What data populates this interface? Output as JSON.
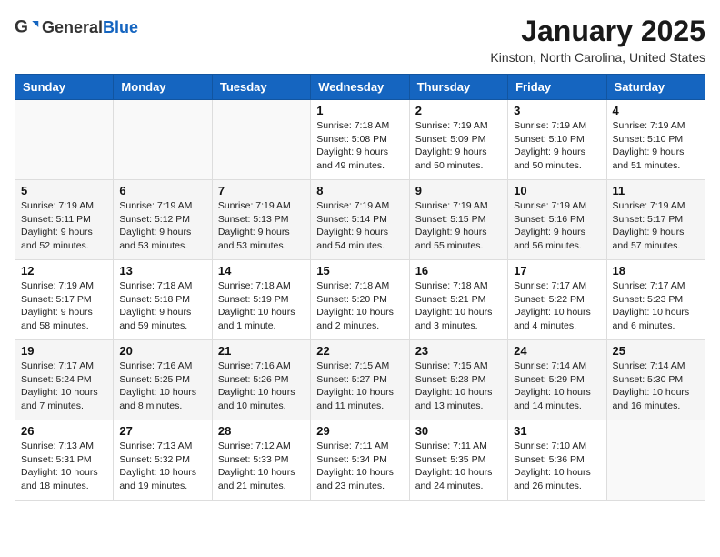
{
  "header": {
    "logo_general": "General",
    "logo_blue": "Blue",
    "title": "January 2025",
    "subtitle": "Kinston, North Carolina, United States"
  },
  "weekdays": [
    "Sunday",
    "Monday",
    "Tuesday",
    "Wednesday",
    "Thursday",
    "Friday",
    "Saturday"
  ],
  "weeks": [
    [
      {
        "day": "",
        "content": ""
      },
      {
        "day": "",
        "content": ""
      },
      {
        "day": "",
        "content": ""
      },
      {
        "day": "1",
        "content": "Sunrise: 7:18 AM\nSunset: 5:08 PM\nDaylight: 9 hours\nand 49 minutes."
      },
      {
        "day": "2",
        "content": "Sunrise: 7:19 AM\nSunset: 5:09 PM\nDaylight: 9 hours\nand 50 minutes."
      },
      {
        "day": "3",
        "content": "Sunrise: 7:19 AM\nSunset: 5:10 PM\nDaylight: 9 hours\nand 50 minutes."
      },
      {
        "day": "4",
        "content": "Sunrise: 7:19 AM\nSunset: 5:10 PM\nDaylight: 9 hours\nand 51 minutes."
      }
    ],
    [
      {
        "day": "5",
        "content": "Sunrise: 7:19 AM\nSunset: 5:11 PM\nDaylight: 9 hours\nand 52 minutes."
      },
      {
        "day": "6",
        "content": "Sunrise: 7:19 AM\nSunset: 5:12 PM\nDaylight: 9 hours\nand 53 minutes."
      },
      {
        "day": "7",
        "content": "Sunrise: 7:19 AM\nSunset: 5:13 PM\nDaylight: 9 hours\nand 53 minutes."
      },
      {
        "day": "8",
        "content": "Sunrise: 7:19 AM\nSunset: 5:14 PM\nDaylight: 9 hours\nand 54 minutes."
      },
      {
        "day": "9",
        "content": "Sunrise: 7:19 AM\nSunset: 5:15 PM\nDaylight: 9 hours\nand 55 minutes."
      },
      {
        "day": "10",
        "content": "Sunrise: 7:19 AM\nSunset: 5:16 PM\nDaylight: 9 hours\nand 56 minutes."
      },
      {
        "day": "11",
        "content": "Sunrise: 7:19 AM\nSunset: 5:17 PM\nDaylight: 9 hours\nand 57 minutes."
      }
    ],
    [
      {
        "day": "12",
        "content": "Sunrise: 7:19 AM\nSunset: 5:17 PM\nDaylight: 9 hours\nand 58 minutes."
      },
      {
        "day": "13",
        "content": "Sunrise: 7:18 AM\nSunset: 5:18 PM\nDaylight: 9 hours\nand 59 minutes."
      },
      {
        "day": "14",
        "content": "Sunrise: 7:18 AM\nSunset: 5:19 PM\nDaylight: 10 hours\nand 1 minute."
      },
      {
        "day": "15",
        "content": "Sunrise: 7:18 AM\nSunset: 5:20 PM\nDaylight: 10 hours\nand 2 minutes."
      },
      {
        "day": "16",
        "content": "Sunrise: 7:18 AM\nSunset: 5:21 PM\nDaylight: 10 hours\nand 3 minutes."
      },
      {
        "day": "17",
        "content": "Sunrise: 7:17 AM\nSunset: 5:22 PM\nDaylight: 10 hours\nand 4 minutes."
      },
      {
        "day": "18",
        "content": "Sunrise: 7:17 AM\nSunset: 5:23 PM\nDaylight: 10 hours\nand 6 minutes."
      }
    ],
    [
      {
        "day": "19",
        "content": "Sunrise: 7:17 AM\nSunset: 5:24 PM\nDaylight: 10 hours\nand 7 minutes."
      },
      {
        "day": "20",
        "content": "Sunrise: 7:16 AM\nSunset: 5:25 PM\nDaylight: 10 hours\nand 8 minutes."
      },
      {
        "day": "21",
        "content": "Sunrise: 7:16 AM\nSunset: 5:26 PM\nDaylight: 10 hours\nand 10 minutes."
      },
      {
        "day": "22",
        "content": "Sunrise: 7:15 AM\nSunset: 5:27 PM\nDaylight: 10 hours\nand 11 minutes."
      },
      {
        "day": "23",
        "content": "Sunrise: 7:15 AM\nSunset: 5:28 PM\nDaylight: 10 hours\nand 13 minutes."
      },
      {
        "day": "24",
        "content": "Sunrise: 7:14 AM\nSunset: 5:29 PM\nDaylight: 10 hours\nand 14 minutes."
      },
      {
        "day": "25",
        "content": "Sunrise: 7:14 AM\nSunset: 5:30 PM\nDaylight: 10 hours\nand 16 minutes."
      }
    ],
    [
      {
        "day": "26",
        "content": "Sunrise: 7:13 AM\nSunset: 5:31 PM\nDaylight: 10 hours\nand 18 minutes."
      },
      {
        "day": "27",
        "content": "Sunrise: 7:13 AM\nSunset: 5:32 PM\nDaylight: 10 hours\nand 19 minutes."
      },
      {
        "day": "28",
        "content": "Sunrise: 7:12 AM\nSunset: 5:33 PM\nDaylight: 10 hours\nand 21 minutes."
      },
      {
        "day": "29",
        "content": "Sunrise: 7:11 AM\nSunset: 5:34 PM\nDaylight: 10 hours\nand 23 minutes."
      },
      {
        "day": "30",
        "content": "Sunrise: 7:11 AM\nSunset: 5:35 PM\nDaylight: 10 hours\nand 24 minutes."
      },
      {
        "day": "31",
        "content": "Sunrise: 7:10 AM\nSunset: 5:36 PM\nDaylight: 10 hours\nand 26 minutes."
      },
      {
        "day": "",
        "content": ""
      }
    ]
  ]
}
